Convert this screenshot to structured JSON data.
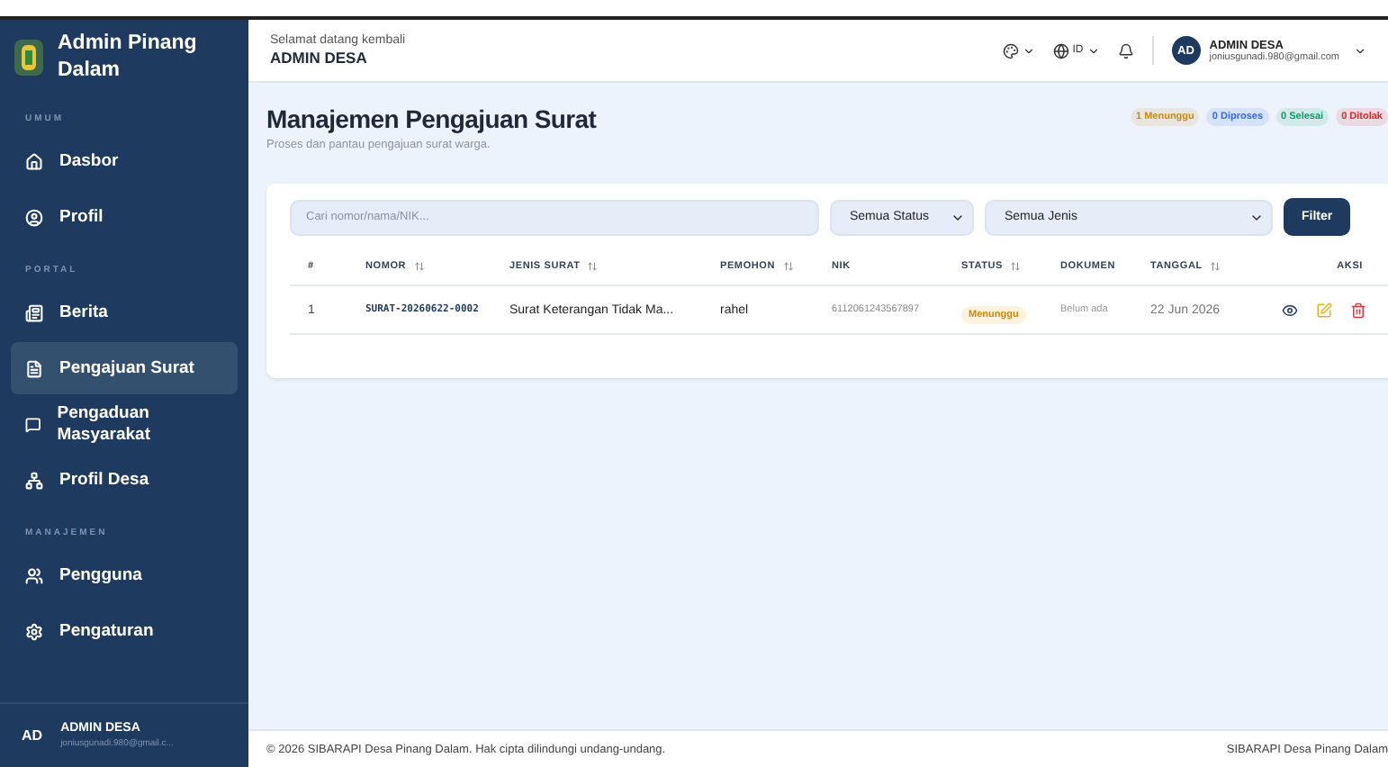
{
  "sidebar": {
    "brand": "Admin Pinang Dalam",
    "sections": [
      {
        "title": "UMUM",
        "items": [
          {
            "label": "Dasbor",
            "selected": false
          },
          {
            "label": "Profil",
            "selected": false
          }
        ]
      },
      {
        "title": "PORTAL",
        "items": [
          {
            "label": "Berita",
            "selected": false
          },
          {
            "label": "Pengajuan Surat",
            "selected": true
          },
          {
            "label": "Pengaduan Masyarakat",
            "selected": false
          },
          {
            "label": "Profil Desa",
            "selected": false
          }
        ]
      },
      {
        "title": "MANAJEMEN",
        "items": [
          {
            "label": "Pengguna",
            "selected": false
          },
          {
            "label": "Pengaturan",
            "selected": false
          }
        ]
      }
    ],
    "user": {
      "initials": "AD",
      "name": "ADMIN DESA",
      "email": "joniusgunadi.980@gmail.c..."
    }
  },
  "header": {
    "greeting": "Selamat datang kembali",
    "name": "ADMIN DESA",
    "language": "ID",
    "user": {
      "initials": "AD",
      "name": "ADMIN DESA",
      "email": "joniusgunadi.980@gmail.com"
    }
  },
  "page": {
    "title": "Manajemen Pengajuan Surat",
    "subtitle": "Proses dan pantau pengajuan surat warga.",
    "badges": [
      {
        "label": "1 Menunggu",
        "color": "#c98a06"
      },
      {
        "label": "0 Diproses",
        "color": "#2f6bed"
      },
      {
        "label": "0 Selesai",
        "color": "#139a64"
      },
      {
        "label": "0 Ditolak",
        "color": "#dc2b2b"
      }
    ]
  },
  "filters": {
    "search": {
      "placeholder": "Cari nomor/nama/NIK..."
    },
    "status": "Semua Status",
    "type": "Semua Jenis",
    "button": "Filter"
  },
  "table": {
    "columns": [
      {
        "label": "#",
        "sortable": false
      },
      {
        "label": "NOMOR",
        "sortable": true
      },
      {
        "label": "JENIS SURAT",
        "sortable": true
      },
      {
        "label": "PEMOHON",
        "sortable": true
      },
      {
        "label": "NIK",
        "sortable": false
      },
      {
        "label": "STATUS",
        "sortable": true
      },
      {
        "label": "DOKUMEN",
        "sortable": false
      },
      {
        "label": "TANGGAL",
        "sortable": true
      },
      {
        "label": "AKSI",
        "sortable": false
      }
    ],
    "rows": [
      {
        "index": "1",
        "number": "SURAT-20260622-0002",
        "type": "Surat Keterangan Tidak Ma...",
        "applicant": "rahel",
        "nik": "6112061243567897",
        "status": "Menunggu",
        "document": "Belum ada",
        "date": "22 Jun 2026"
      }
    ]
  },
  "footer": {
    "copyright": "© 2026 SIBARAPI Desa Pinang Dalam. Hak cipta dilindungi undang-undang.",
    "right": "SIBARAPI Desa Pinang Dalam"
  }
}
